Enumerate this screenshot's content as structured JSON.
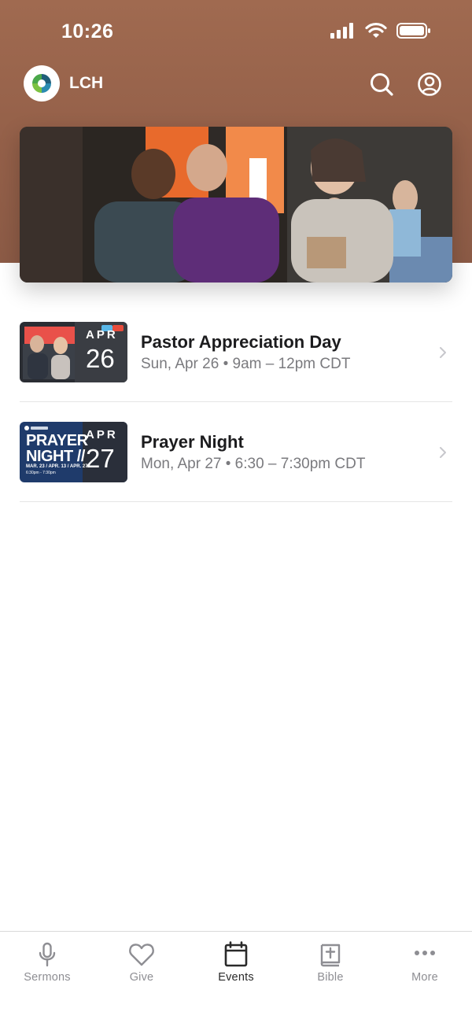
{
  "status_bar": {
    "time": "10:26"
  },
  "app_bar": {
    "title": "LCH"
  },
  "events": [
    {
      "title": "Pastor Appreciation Day",
      "meta": "Sun, Apr 26 • 9am – 12pm CDT",
      "month": "APR",
      "day": "26"
    },
    {
      "title": "Prayer Night",
      "meta": "Mon, Apr 27 • 6:30 – 7:30pm CDT",
      "month": "APR",
      "day": "27",
      "thumb_text": "PRAYER NIGHT //",
      "thumb_dates": "MAR. 23 / APR. 13 / APR. 27",
      "thumb_time": "6:30pm - 7:30pm"
    }
  ],
  "tabs": [
    {
      "label": "Sermons",
      "icon": "microphone-icon",
      "active": false
    },
    {
      "label": "Give",
      "icon": "heart-icon",
      "active": false
    },
    {
      "label": "Events",
      "icon": "calendar-icon",
      "active": true
    },
    {
      "label": "Bible",
      "icon": "bible-icon",
      "active": false
    },
    {
      "label": "More",
      "icon": "more-dots-icon",
      "active": false
    }
  ],
  "colors": {
    "header": "#946049",
    "active_tab": "#2a2a2a",
    "inactive_tab": "#8e8e93",
    "thumb_prayer": "#1f3b6b"
  }
}
